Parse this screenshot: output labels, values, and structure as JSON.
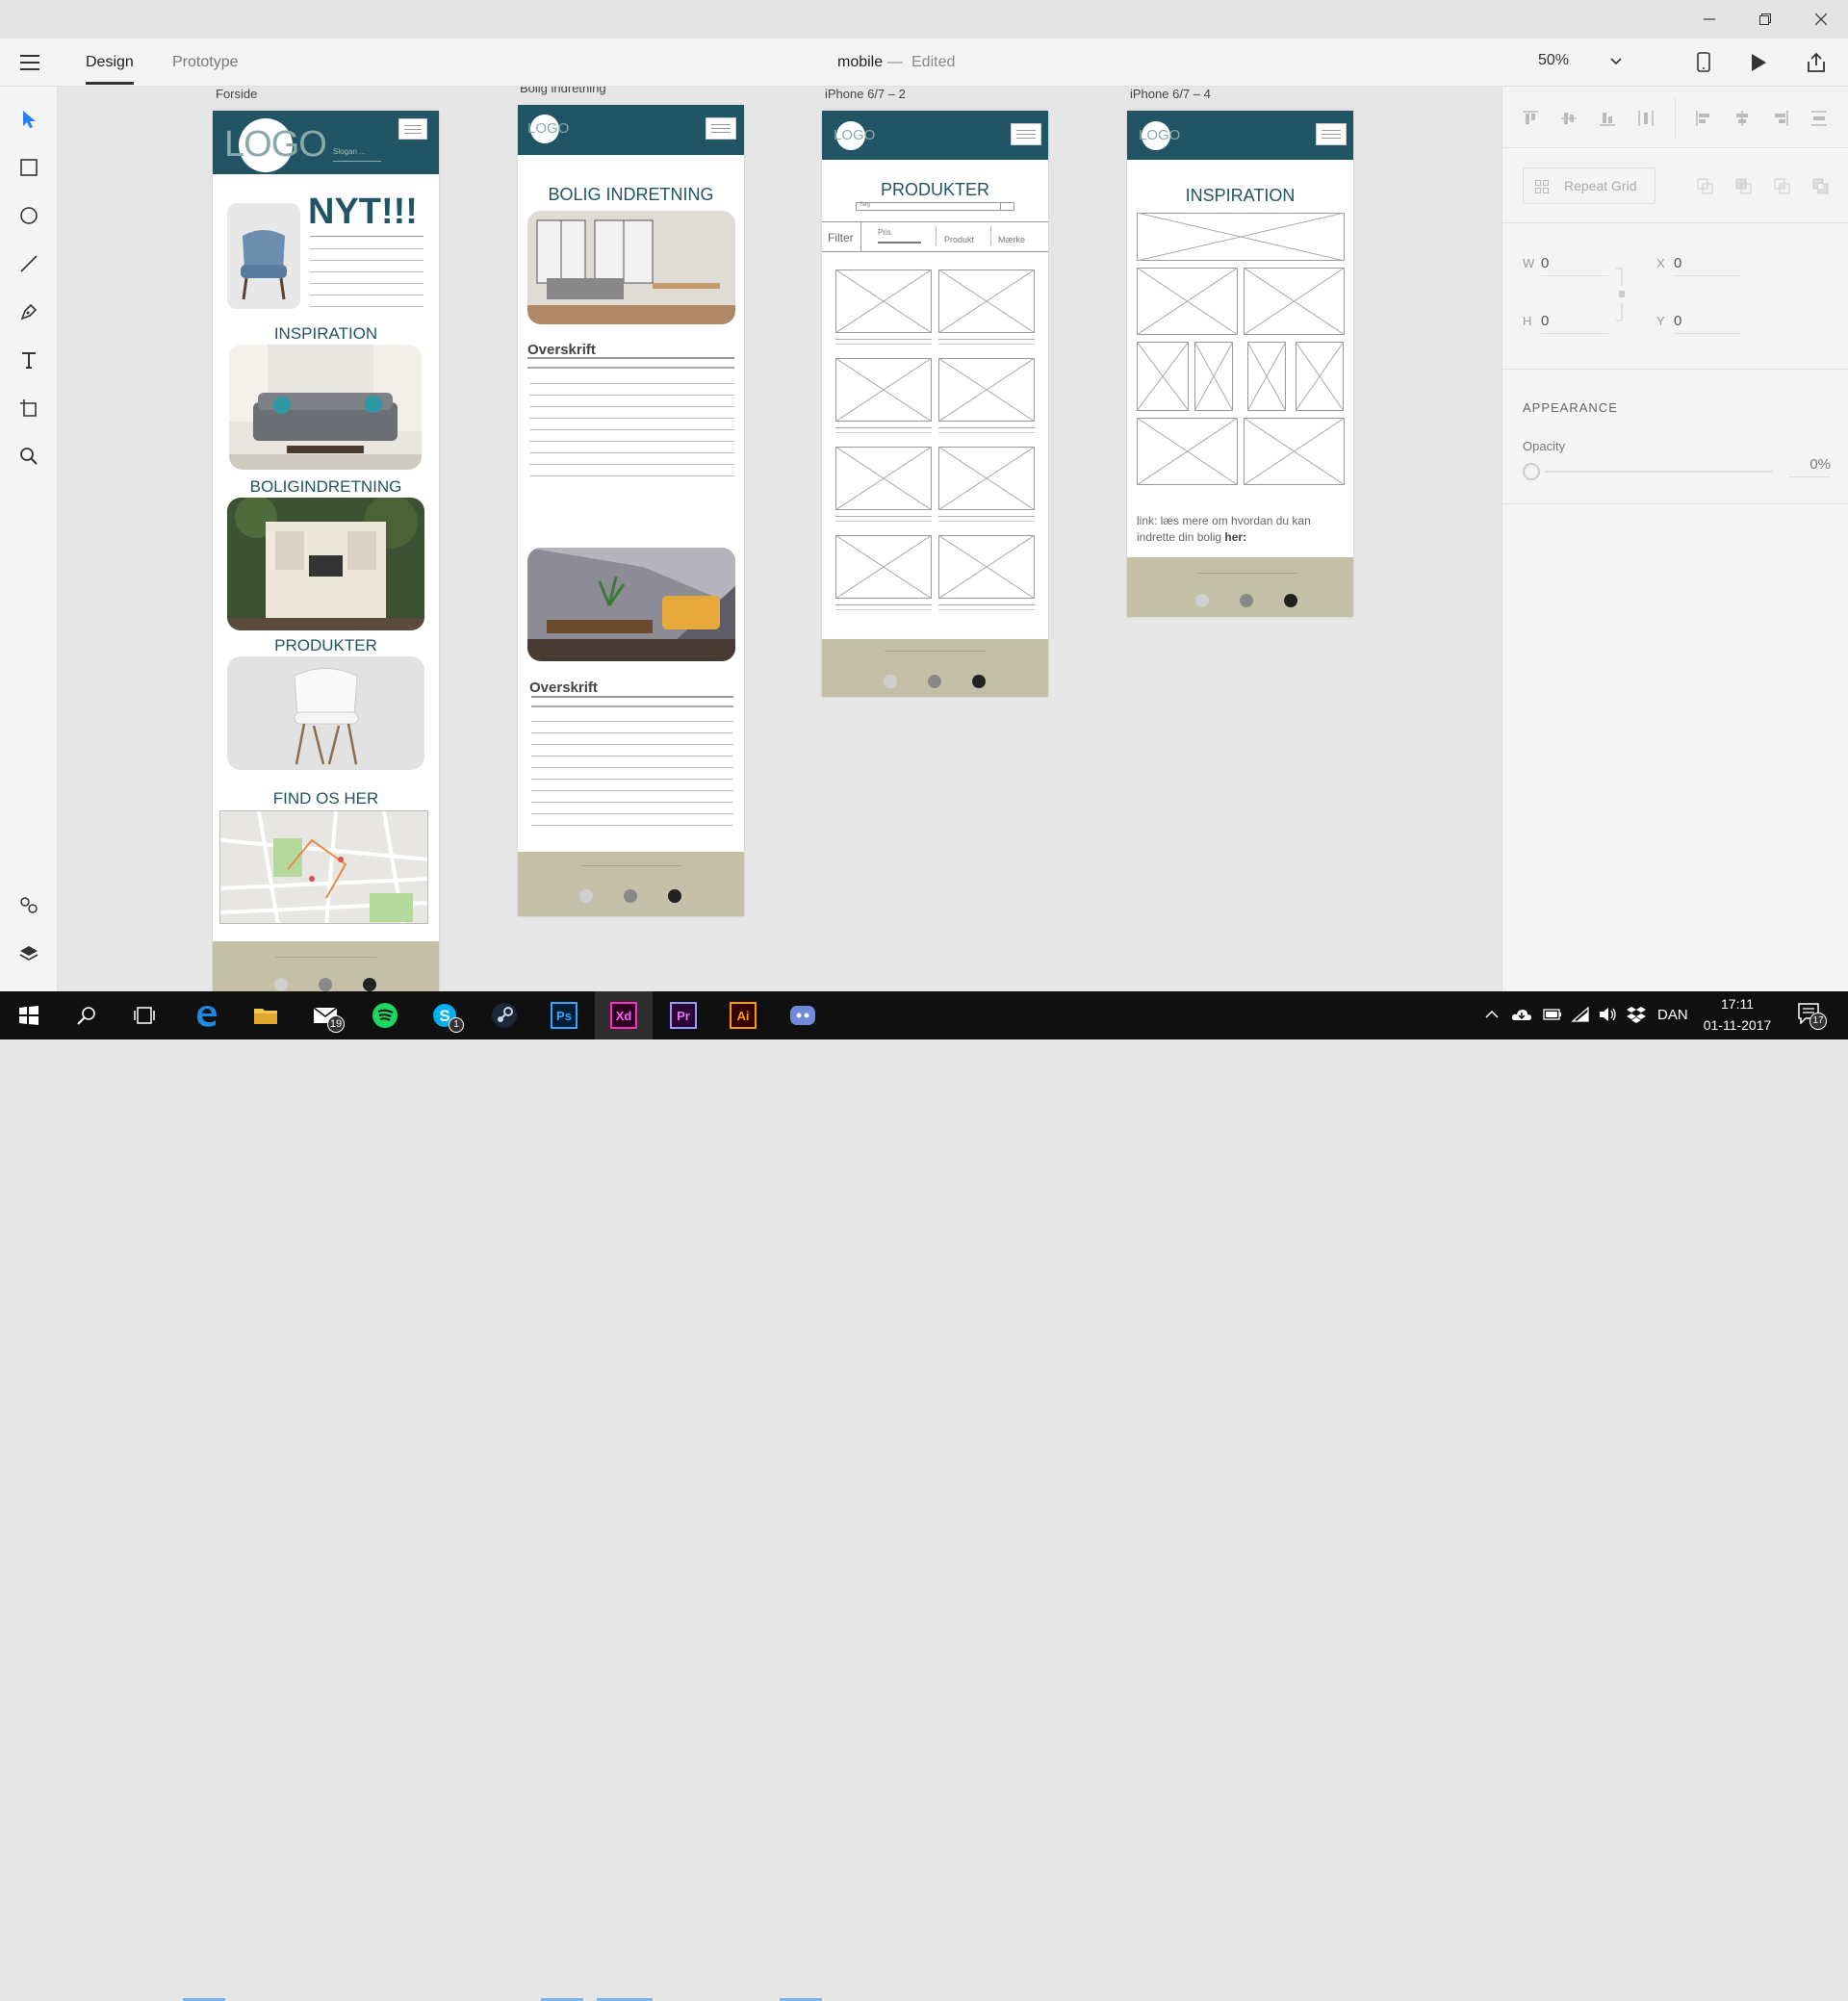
{
  "window": {
    "title": "mobile",
    "status": "Edited",
    "separator": "—"
  },
  "toolbar": {
    "tabs": [
      {
        "label": "Design",
        "active": true
      },
      {
        "label": "Prototype",
        "active": false
      }
    ],
    "zoom": "50%"
  },
  "tools": [
    "select-icon",
    "rectangle-icon",
    "ellipse-icon",
    "line-icon",
    "pen-icon",
    "text-icon",
    "artboard-icon",
    "zoom-icon",
    "symbols-icon",
    "layers-icon"
  ],
  "artboards": {
    "forside": {
      "label": "Forside",
      "logo": "LOGO",
      "slogan": "Slogan ...",
      "news": "NYT!!!",
      "sections": [
        "INSPIRATION",
        "BOLIGINDRETNING",
        "PRODUKTER",
        "FIND OS HER"
      ]
    },
    "bolig": {
      "label": "Bolig indretning",
      "logo": "LOGO",
      "title": "BOLIG INDRETNING",
      "heading1": "Overskrift",
      "heading2": "Overskrift"
    },
    "produkter": {
      "label": "iPhone 6/7 – 2",
      "logo": "LOGO",
      "title": "PRODUKTER",
      "search_placeholder": "Søg",
      "filter": "Filter",
      "filter_options": [
        "Pris",
        "Produkt",
        "Mærke"
      ]
    },
    "inspiration": {
      "label": "iPhone 6/7 – 4",
      "logo": "LOGO",
      "title": "INSPIRATION",
      "link_text": "link: læs mere om hvordan du kan indrette din bolig",
      "link_bold": "her:"
    }
  },
  "right_panel": {
    "repeat_grid": "Repeat Grid",
    "w_label": "W",
    "w_value": "0",
    "h_label": "H",
    "h_value": "0",
    "x_label": "X",
    "x_value": "0",
    "y_label": "Y",
    "y_value": "0",
    "appearance": "APPEARANCE",
    "opacity_label": "Opacity",
    "opacity_value": "0%"
  },
  "taskbar": {
    "apps": [
      "start-icon",
      "search-icon",
      "task-view-icon",
      "edge-icon",
      "file-explorer-icon",
      "mail-icon",
      "spotify-icon",
      "skype-icon",
      "steam-icon",
      "photoshop-icon",
      "xd-icon",
      "premiere-icon",
      "illustrator-icon",
      "discord-icon"
    ],
    "mail_badge": "19",
    "skype_badge": "1",
    "ps_label": "Ps",
    "xd_label": "Xd",
    "pr_label": "Pr",
    "ai_label": "Ai",
    "language": "DAN",
    "time": "17:11",
    "date": "01-11-2017",
    "notifications": "17"
  },
  "colors": {
    "header_teal": "#215566",
    "footer_beige": "#c4c0a8",
    "accent_blue": "#2680eb",
    "xd_pink": "#ff2bc2"
  }
}
